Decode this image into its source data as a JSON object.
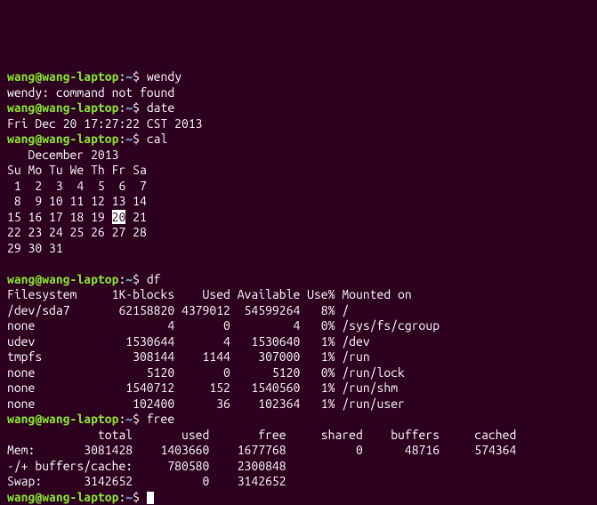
{
  "prompt": {
    "user_host": "wang@wang-laptop",
    "path": "~",
    "sep1": ":",
    "sep2": "$"
  },
  "cmds": {
    "wendy": "wendy",
    "date": "date",
    "cal": "cal",
    "df": "df",
    "free": "free"
  },
  "output": {
    "wendy_err": "wendy: command not found",
    "date_out": "Fri Dec 20 17:27:22 CST 2013",
    "cal": {
      "header": "   December 2013",
      "dow": "Su Mo Tu We Th Fr Sa",
      "w1": " 1  2  3  4  5  6  7",
      "w2": " 8  9 10 11 12 13 14",
      "w3a": "15 16 17 18 19 ",
      "today": "20",
      "w3b": " 21",
      "w4": "22 23 24 25 26 27 28",
      "w5": "29 30 31"
    },
    "df": {
      "hdr": "Filesystem     1K-blocks    Used Available Use% Mounted on",
      "r1": "/dev/sda7       62158820 4379012  54599264   8% /",
      "r2": "none                   4       0         4   0% /sys/fs/cgroup",
      "r3": "udev             1530644       4   1530640   1% /dev",
      "r4": "tmpfs             308144    1144    307000   1% /run",
      "r5": "none                5120       0      5120   0% /run/lock",
      "r6": "none             1540712     152   1540560   1% /run/shm",
      "r7": "none              102400      36    102364   1% /run/user"
    },
    "free": {
      "hdr": "             total       used       free     shared    buffers     cached",
      "r1": "Mem:       3081428    1403660    1677768          0      48716     574364",
      "r2": "-/+ buffers/cache:     780580    2300848",
      "r3": "Swap:      3142652          0    3142652"
    }
  }
}
